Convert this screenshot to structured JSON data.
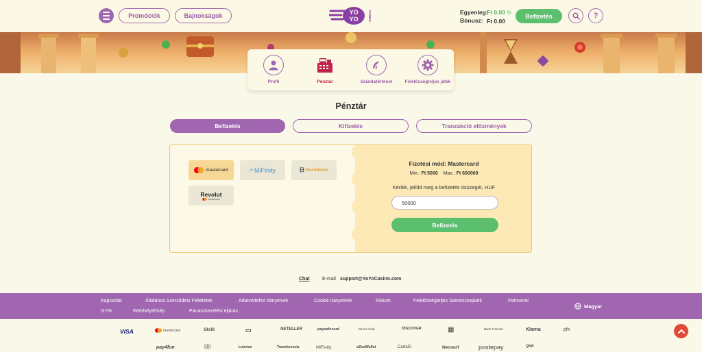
{
  "header": {
    "promo_label": "Promóciók",
    "tournaments_label": "Bajnokságok",
    "logo_text_1": "YO",
    "logo_text_2": "YO",
    "logo_text_3": "CASINO",
    "balance_label": "Egyenleg:",
    "balance_value": "Ft 0.00",
    "bonus_label": "Bónusz:",
    "bonus_value": "Ft 0.00",
    "deposit_label": "Befizetés",
    "help_label": "?"
  },
  "account_nav": [
    {
      "label": "Profil",
      "icon": "user-icon"
    },
    {
      "label": "Pénztár",
      "icon": "cash-register-icon"
    },
    {
      "label": "Számlatörténet",
      "icon": "history-icon"
    },
    {
      "label": "Felelősségteljes játék",
      "icon": "gear-icon"
    }
  ],
  "page_title": "Pénztár",
  "tabs": [
    "Befizetés",
    "Kifizetés",
    "Tranzakció előzmények"
  ],
  "methods": [
    {
      "name": "mastercard"
    },
    {
      "name": "MiFinity"
    },
    {
      "name": "MuchBetter"
    },
    {
      "name": "Revolut",
      "sub": "mastercard"
    }
  ],
  "payment": {
    "title": "Fizetési mód: Mastercard",
    "min_label": "Min.:",
    "min_value": "Ft 5000",
    "max_label": "Max.:",
    "max_value": "Ft 600000",
    "prompt": "Kérlek, jelöld meg a befizetés összegét, HUF",
    "amount": "50000",
    "submit_label": "Befizetés"
  },
  "contact": {
    "chat": "Chat",
    "email_label": "E-mail",
    "email": "support@YoYoCasino.com"
  },
  "footer": {
    "links_row1": [
      "Kapcsolat",
      "Általános Szerződési Feltételek",
      "Adatvédelmi Irányelvek",
      "Cookie Irányelvek",
      "Rólunk",
      "Felelősségteljes Szerencsejáték",
      "Partnerek"
    ],
    "links_row2": [
      "GYIK",
      "Webhelytérkép",
      "Panaszkezelési eljárás"
    ],
    "language": "Magyar"
  },
  "payment_logos": {
    "row1": [
      "VISA",
      "mastercard",
      "Skrill",
      "▭",
      "NETELLER",
      "paysafecard",
      "Diners Club",
      "DISCOVER",
      "▦",
      "Bank Transfer",
      "Klarna",
      "pfx"
    ],
    "row2": [
      "pay4fun",
      "|||||",
      "Loterias",
      "Transferencia",
      "MiFinity",
      "eZeeWallet",
      "CartaSi",
      "Neosurf",
      "postepay",
      "QIWI"
    ]
  },
  "colors": {
    "brand_purple": "#a066b0",
    "green": "#5cbf6e",
    "cream": "#faf8e8"
  }
}
